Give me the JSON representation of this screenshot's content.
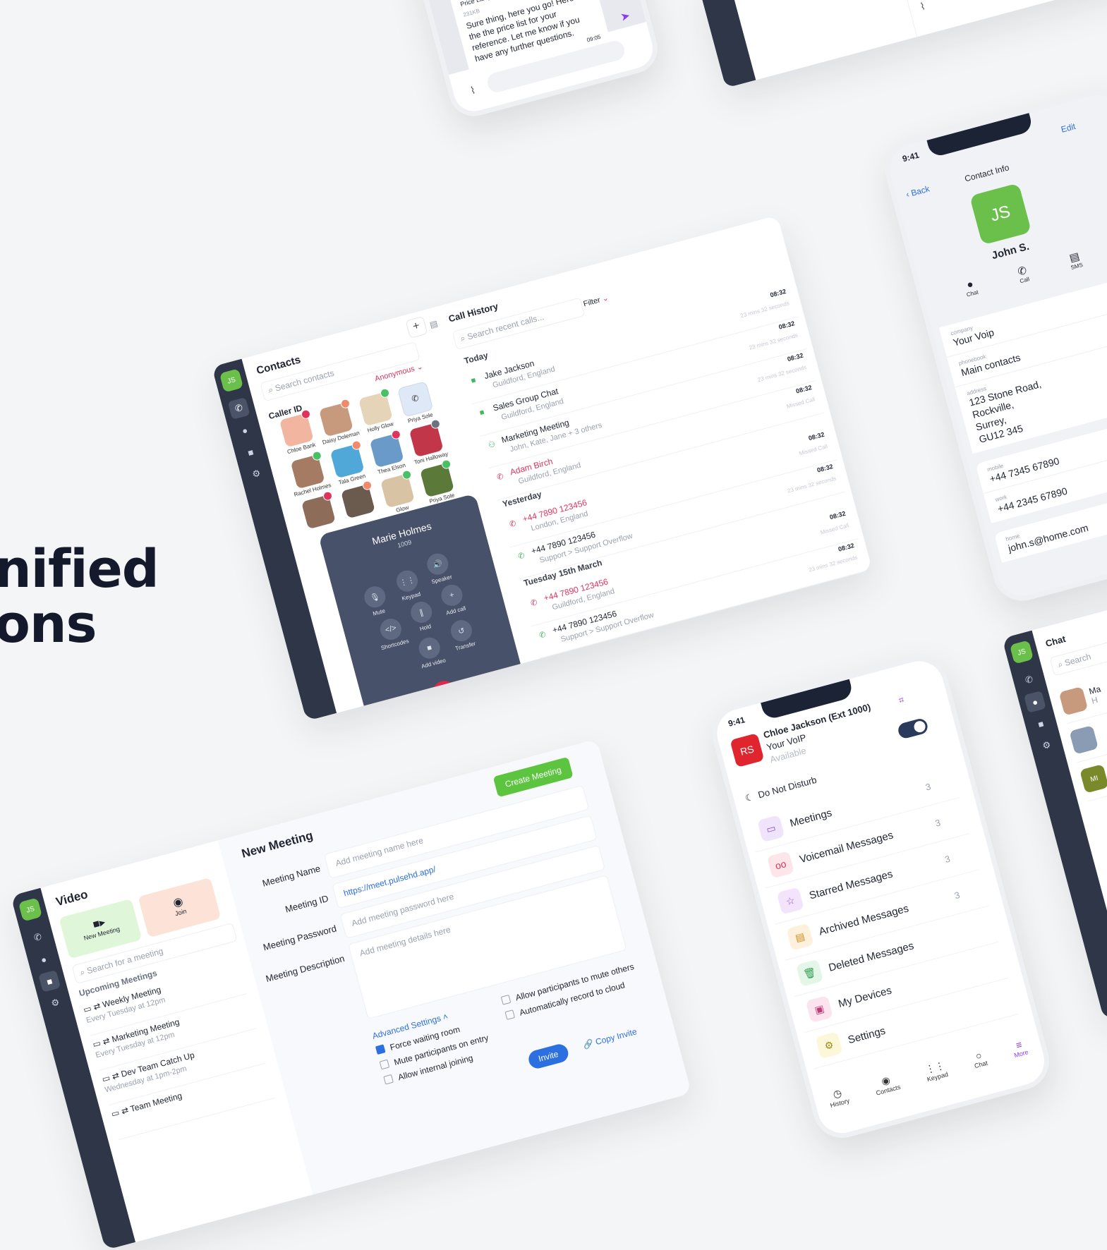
{
  "hero": {
    "line1": "nified",
    "line2": "ons"
  },
  "chat_snip": {
    "file_name": "Price List.pdf",
    "file_size": "231KB",
    "message": "Sure thing, here you go! Here is the the price list for your reference. Let me know if you have any further questions.",
    "time": "09:05"
  },
  "desktop": {
    "avatar": "JS",
    "contacts": {
      "title": "Contacts",
      "search_placeholder": "Search contacts",
      "caller_id_label": "Caller ID",
      "caller_id_value": "Anonymous",
      "people": [
        {
          "name": "Chloe Bank",
          "color": "#f2b6a0",
          "status": "#e0335b"
        },
        {
          "name": "Daisy Doleman",
          "color": "#c79a7d",
          "status": "#f08a6a"
        },
        {
          "name": "Holly Glow",
          "color": "#e6d4b8",
          "status": "#49c064"
        },
        {
          "name": "Priya Sole",
          "color": "#dfe8f6",
          "status": ""
        },
        {
          "name": "Rachel Holmes",
          "color": "#a57c63",
          "status": "#49c064"
        },
        {
          "name": "Tala Green",
          "color": "#4fa8d8",
          "status": "#f08a6a"
        },
        {
          "name": "Thea Elson",
          "color": "#6a9bc8",
          "status": "#e0335b"
        },
        {
          "name": "Toni Halloway",
          "color": "#c2364a",
          "status": "#6b7280"
        },
        {
          "name": "",
          "color": "#8d6d5a",
          "status": "#e0335b"
        },
        {
          "name": "",
          "color": "#6b5b4f",
          "status": "#f08a6a"
        },
        {
          "name": "Glow",
          "color": "#d8c4a4",
          "status": "#49c064"
        },
        {
          "name": "Priya Sole",
          "color": "#5b7a3a",
          "status": "#49c064"
        }
      ],
      "extra": [
        {
          "name": "Toni Halloway"
        },
        {
          "name": "Priya Sole"
        },
        {
          "name": "Toni Halloway"
        }
      ]
    },
    "call": {
      "name": "Marie Holmes",
      "ext": "1009",
      "buttons": [
        "Mute",
        "Keypad",
        "Speaker",
        "Shortcodes",
        "Hold",
        "Add call",
        "Add video",
        "Transfer"
      ]
    },
    "history": {
      "title": "Call History",
      "search_placeholder": "Search recent calls...",
      "filter": "Filter",
      "sections": [
        {
          "label": "Today",
          "items": [
            {
              "name": "Jake Jackson",
              "sub": "Guildford, England",
              "time": "08:32",
              "detail": "23 mins 32 seconds",
              "missed": false,
              "icon": "video"
            },
            {
              "name": "Sales Group Chat",
              "sub": "Guildford, England",
              "time": "08:32",
              "detail": "23 mins 32 seconds",
              "missed": false,
              "icon": "video"
            },
            {
              "name": "Marketing Meeting",
              "sub": "John, Kate, Jane + 3 others",
              "time": "08:32",
              "detail": "23 mins 32 seconds",
              "missed": false,
              "icon": "group"
            },
            {
              "name": "Adam Birch",
              "sub": "Guildford, England",
              "time": "08:32",
              "detail": "Missed Call",
              "missed": true,
              "icon": "phone"
            }
          ]
        },
        {
          "label": "Yesterday",
          "items": [
            {
              "name": "+44 7890 123456",
              "sub": "London, England",
              "time": "08:32",
              "detail": "Missed Call",
              "missed": true,
              "icon": "phone"
            },
            {
              "name": "+44 7890 123456",
              "sub": "Support > Support Overflow",
              "time": "08:32",
              "detail": "23 mins 32 seconds",
              "missed": false,
              "icon": "phone"
            }
          ]
        },
        {
          "label": "Tuesday 15th March",
          "items": [
            {
              "name": "+44 7890 123456",
              "sub": "Guildford, England",
              "time": "08:32",
              "detail": "Missed Call",
              "missed": true,
              "icon": "phone"
            },
            {
              "name": "+44 7890 123456",
              "sub": "Support > Support Overflow",
              "time": "08:32",
              "detail": "23 mins 32 seconds",
              "missed": false,
              "icon": "phone"
            },
            {
              "name": "+44 7890 123456",
              "sub": "Support > Support Overflow",
              "time": "08:32",
              "detail": "23 mins 32 seconds",
              "missed": false,
              "icon": "phone"
            }
          ]
        }
      ]
    }
  },
  "contact_info": {
    "status_time": "9:41",
    "back": "Back",
    "title": "Contact Info",
    "edit": "Edit",
    "initials": "JS",
    "name": "John S.",
    "actions": [
      "Chat",
      "Call",
      "SMS"
    ],
    "fields": [
      {
        "k": "company",
        "v": "Your Voip"
      },
      {
        "k": "phonebook",
        "v": "Main contacts"
      },
      {
        "k": "address",
        "v": "123 Stone Road,\nRockville,\nSurrey,\nGU12 345"
      },
      {
        "k": "mobile",
        "v": "+44 7345 67890"
      },
      {
        "k": "work",
        "v": "+44 2345 67890"
      },
      {
        "k": "home",
        "v": "john.s@home.com"
      }
    ]
  },
  "more_phone": {
    "status_time": "9:41",
    "initials": "RS",
    "name": "Chloe Jackson (Ext 1000)",
    "company": "Your VoIP",
    "status": "Available",
    "dnd": "Do Not Disturb",
    "items": [
      {
        "label": "Meetings",
        "count": "3",
        "bg": "#efe4fb",
        "fg": "#8a4fd8",
        "icon": "▭"
      },
      {
        "label": "Voicemail Messages",
        "count": "3",
        "bg": "#fde6ea",
        "fg": "#e0335b",
        "icon": "oo"
      },
      {
        "label": "Starred Messages",
        "count": "3",
        "bg": "#f4e4fb",
        "fg": "#8a4fd8",
        "icon": "☆"
      },
      {
        "label": "Archived Messages",
        "count": "3",
        "bg": "#fdf0dc",
        "fg": "#d88a1a",
        "icon": "▤"
      },
      {
        "label": "Deleted Messages",
        "count": "",
        "bg": "#e4f6e8",
        "fg": "#2f9e4e",
        "icon": "🗑"
      },
      {
        "label": "My Devices",
        "count": "",
        "bg": "#fbe4ee",
        "fg": "#c43a78",
        "icon": "▣"
      },
      {
        "label": "Settings",
        "count": "",
        "bg": "#fbf7d8",
        "fg": "#9c8a12",
        "icon": "⚙"
      }
    ],
    "tabs": [
      "History",
      "Contacts",
      "Keypad",
      "Chat",
      "More"
    ]
  },
  "video": {
    "avatar": "JS",
    "title": "Video",
    "new_meeting": "New Meeting",
    "join": "Join",
    "search_placeholder": "Search for a meeting",
    "upcoming_label": "Upcoming Meetings",
    "meetings": [
      {
        "name": "Weekly Meeting",
        "when": "Every Tuesday at 12pm"
      },
      {
        "name": "Marketing Meeting",
        "when": "Every Tuesday at 12pm"
      },
      {
        "name": "Dev Team Catch Up",
        "when": "Wednesday at 1pm-2pm"
      },
      {
        "name": "Team Meeting",
        "when": ""
      }
    ],
    "form": {
      "title": "New Meeting",
      "create": "Create Meeting",
      "name_label": "Meeting Name",
      "name_placeholder": "Add meeting name here",
      "id_label": "Meeting ID",
      "id_value": "https://meet.pulsehd.app/",
      "password_label": "Meeting Password",
      "password_placeholder": "Add meeting password here",
      "desc_label": "Meeting Description",
      "desc_placeholder": "Add meeting details here",
      "advanced": "Advanced Settings",
      "options_left": [
        {
          "label": "Force waiting room",
          "on": true
        },
        {
          "label": "Mute participants on entry",
          "on": false
        },
        {
          "label": "Allow internal joining",
          "on": false
        }
      ],
      "options_right": [
        {
          "label": "Allow participants to mute others",
          "on": false
        },
        {
          "label": "Automatically record to cloud",
          "on": false
        }
      ],
      "invite": "Invite",
      "copy_invite": "Copy Invite"
    }
  },
  "chat_panel": {
    "avatar": "JS",
    "title": "Chat",
    "search_placeholder": "Search",
    "entries": [
      {
        "initials": "Ma",
        "sub": "H"
      },
      {
        "initials": "",
        "sub": ""
      },
      {
        "initials": "MI",
        "sub": ""
      }
    ]
  },
  "colors": {
    "brand_green": "#6bc04b",
    "rail": "#2f3647",
    "missed": "#e0335b",
    "link": "#2c6fe0",
    "accent_purple": "#8a3cf0"
  }
}
